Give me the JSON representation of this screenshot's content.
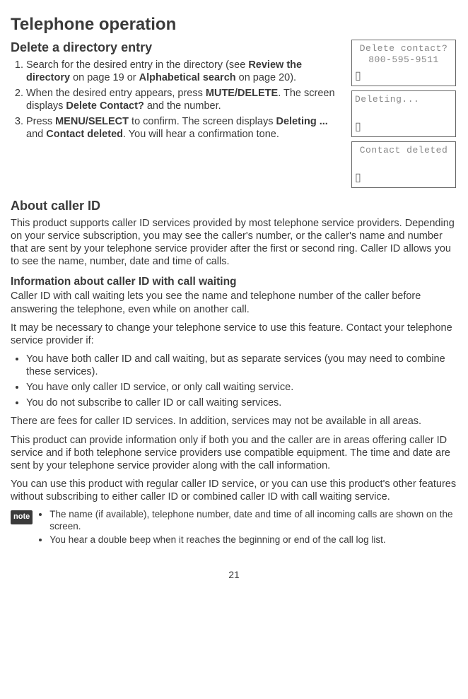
{
  "title": "Telephone operation",
  "section1": {
    "heading": "Delete a directory entry",
    "items": [
      {
        "prefix": "Search for the desired entry in the directory (see ",
        "bold1": "Review the directory",
        "mid1": " on page 19 or ",
        "bold2": "Alphabetical search",
        "suffix": " on page 20)."
      },
      {
        "prefix": "When the desired entry appears, press ",
        "key": "MUTE/DELETE",
        "mid": ". The screen displays ",
        "bold": "Delete Contact?",
        "suffix": " and the number."
      },
      {
        "prefix": "Press ",
        "key": "MENU/SELECT",
        "mid1": " to confirm. The screen displays ",
        "bold1": "Deleting ...",
        "mid2": " and ",
        "bold2": "Contact deleted",
        "suffix": ". You will hear a confirmation tone."
      }
    ]
  },
  "lcd": [
    {
      "line1": "Delete contact?",
      "line2": "800-595-9511"
    },
    {
      "line1": "Deleting...",
      "line2": ""
    },
    {
      "line1": "Contact deleted",
      "line2": ""
    }
  ],
  "section2": {
    "heading": "About caller ID",
    "para1": "This product supports caller ID services provided by most telephone service providers. Depending on your service subscription, you may see the caller's number, or the caller's name and number that are sent by your telephone service provider after the first or second ring. Caller ID allows you to see the name, number, date and time of calls.",
    "subheading": "Information about caller ID with call waiting",
    "para2": "Caller ID with call waiting lets you see the name and telephone number of the caller before answering the telephone, even while on another call.",
    "para3": "It may be necessary to change your telephone service to use this feature. Contact your telephone service provider if:",
    "bullets": [
      "You have both caller ID and call waiting, but as separate services (you may need to combine these services).",
      "You have only caller ID service, or only call waiting service.",
      "You do not subscribe to caller ID or call waiting services."
    ],
    "para4": "There are fees for caller ID services. In addition, services may not be available in all areas.",
    "para5": "This product can provide information only if both you and the caller are in areas offering caller ID service and if both telephone service providers use compatible equipment. The time and date are sent by your telephone service provider along with the call information.",
    "para6": "You can use this product with regular caller ID service, or you can use this product's other features without subscribing to either caller ID or combined caller ID with call waiting service."
  },
  "note": {
    "badge": "note",
    "items": [
      "The name (if available), telephone number, date and time of all incoming calls are shown on the screen.",
      "You hear a double beep when it reaches the beginning or end of the call log list."
    ]
  },
  "page": "21"
}
